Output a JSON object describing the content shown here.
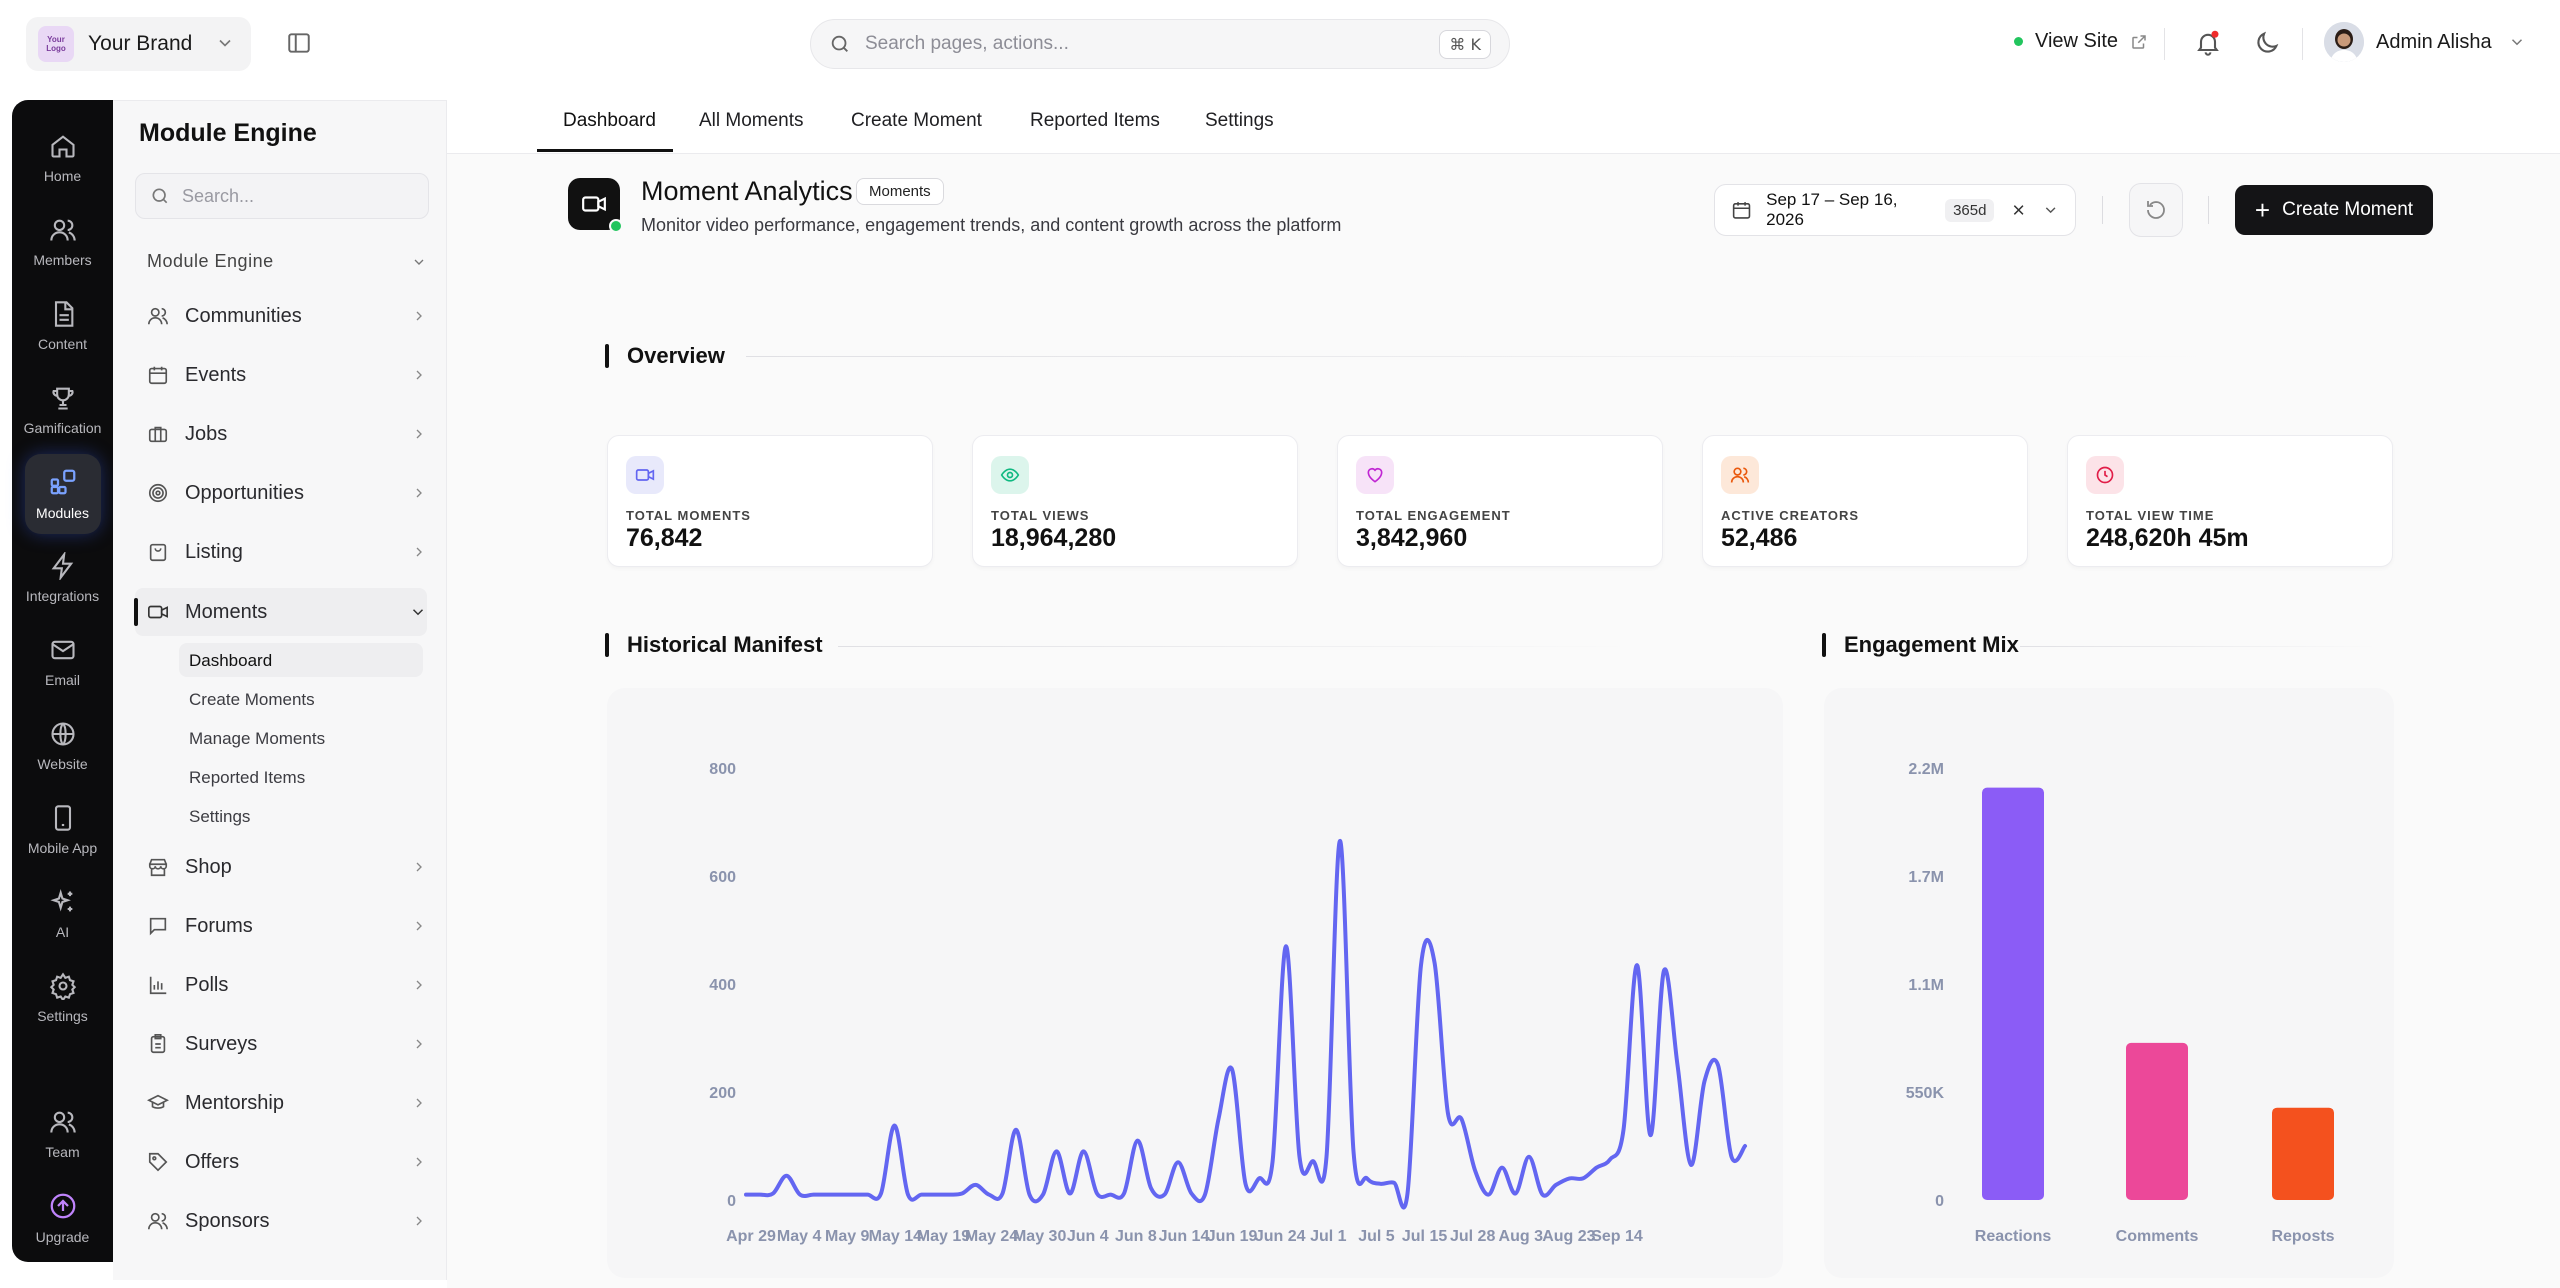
{
  "brand": {
    "name": "Your Brand",
    "logo_text": "Your Logo"
  },
  "search": {
    "placeholder": "Search pages, actions...",
    "shortcut": "⌘ K"
  },
  "header": {
    "view_site": "View Site",
    "user_name": "Admin Alisha"
  },
  "rail": [
    {
      "label": "Home",
      "icon": "home-icon"
    },
    {
      "label": "Members",
      "icon": "users-icon"
    },
    {
      "label": "Content",
      "icon": "document-icon"
    },
    {
      "label": "Gamification",
      "icon": "trophy-icon"
    },
    {
      "label": "Modules",
      "icon": "modules-icon",
      "active": true
    },
    {
      "label": "Integrations",
      "icon": "bolt-icon"
    },
    {
      "label": "Email",
      "icon": "mail-icon"
    },
    {
      "label": "Website",
      "icon": "globe-icon"
    },
    {
      "label": "Mobile App",
      "icon": "phone-icon"
    },
    {
      "label": "AI",
      "icon": "sparkles-icon"
    },
    {
      "label": "Settings",
      "icon": "gear-icon"
    },
    {
      "label": "Team",
      "icon": "team-icon"
    },
    {
      "label": "Upgrade",
      "icon": "upgrade-icon"
    }
  ],
  "module_panel": {
    "title": "Module Engine",
    "search_placeholder": "Search...",
    "group": "Module Engine",
    "items": [
      {
        "label": "Communities",
        "icon": "users-icon"
      },
      {
        "label": "Events",
        "icon": "calendar-icon"
      },
      {
        "label": "Jobs",
        "icon": "briefcase-icon"
      },
      {
        "label": "Opportunities",
        "icon": "target-icon"
      },
      {
        "label": "Listing",
        "icon": "bag-icon"
      },
      {
        "label": "Moments",
        "icon": "video-icon",
        "open": true
      },
      {
        "label": "Shop",
        "icon": "store-icon"
      },
      {
        "label": "Forums",
        "icon": "message-icon"
      },
      {
        "label": "Polls",
        "icon": "bar-chart-icon"
      },
      {
        "label": "Surveys",
        "icon": "clipboard-icon"
      },
      {
        "label": "Mentorship",
        "icon": "graduation-icon"
      },
      {
        "label": "Offers",
        "icon": "tag-icon"
      },
      {
        "label": "Sponsors",
        "icon": "users-icon"
      }
    ],
    "moments_sub": [
      "Dashboard",
      "Create Moments",
      "Manage Moments",
      "Reported Items",
      "Settings"
    ]
  },
  "tabs": [
    "Dashboard",
    "All Moments",
    "Create Moment",
    "Reported Items",
    "Settings"
  ],
  "page": {
    "title": "Moment Analytics",
    "badge": "Moments",
    "subtitle": "Monitor video performance, engagement trends, and content growth across the platform",
    "date_range": "Sep 17 – Sep 16, 2026",
    "days": "365d",
    "create_label": "Create Moment"
  },
  "overview": {
    "title": "Overview",
    "stats": [
      {
        "label": "TOTAL MOMENTS",
        "value": "76,842",
        "icon": "video-icon",
        "color": "#6366f1",
        "bg": "#e8e9fb"
      },
      {
        "label": "TOTAL VIEWS",
        "value": "18,964,280",
        "icon": "eye-icon",
        "color": "#10b981",
        "bg": "#dcf5ec"
      },
      {
        "label": "TOTAL ENGAGEMENT",
        "value": "3,842,960",
        "icon": "heart-icon",
        "color": "#c026d3",
        "bg": "#f7e3f8"
      },
      {
        "label": "ACTIVE CREATORS",
        "value": "52,486",
        "icon": "users-icon",
        "color": "#ea580c",
        "bg": "#fde8d9"
      },
      {
        "label": "TOTAL VIEW TIME",
        "value": "248,620h 45m",
        "icon": "clock-icon",
        "color": "#e11d48",
        "bg": "#fce3e8"
      }
    ]
  },
  "chart_data": [
    {
      "type": "line",
      "title": "Historical Manifest",
      "color": "#6366f1",
      "ylim": [
        0,
        800
      ],
      "yticks": [
        0,
        200,
        400,
        600,
        800
      ],
      "xticks": [
        "Apr 29",
        "May 4",
        "May 9",
        "May 14",
        "May 19",
        "May 24",
        "May 30",
        "Jun 4",
        "Jun 8",
        "Jun 14",
        "Jun 19",
        "Jun 24",
        "Jul 1",
        "Jul 5",
        "Jul 15",
        "Jul 28",
        "Aug 3",
        "Aug 23",
        "Sep 14"
      ],
      "values": [
        10,
        10,
        12,
        45,
        10,
        10,
        10,
        10,
        10,
        10,
        12,
        138,
        10,
        10,
        10,
        10,
        12,
        28,
        10,
        12,
        130,
        10,
        10,
        90,
        12,
        90,
        12,
        10,
        12,
        110,
        22,
        10,
        70,
        12,
        10,
        150,
        242,
        30,
        40,
        70,
        470,
        80,
        72,
        80,
        665,
        90,
        40,
        30,
        32,
        12,
        435,
        440,
        160,
        150,
        55,
        10,
        60,
        12,
        80,
        10,
        28,
        40,
        40,
        60,
        75,
        130,
        435,
        120,
        425,
        250,
        65,
        220,
        250,
        80,
        100
      ]
    },
    {
      "type": "bar",
      "title": "Engagement Mix",
      "ylim": [
        0,
        2200000
      ],
      "yticks": [
        "0",
        "550K",
        "1.1M",
        "1.7M",
        "2.2M"
      ],
      "categories": [
        "Reactions",
        "Comments",
        "Reposts"
      ],
      "values": [
        2100000,
        800000,
        470000
      ],
      "colors": [
        "#8b5cf6",
        "#ec4899",
        "#f4511e"
      ]
    }
  ]
}
